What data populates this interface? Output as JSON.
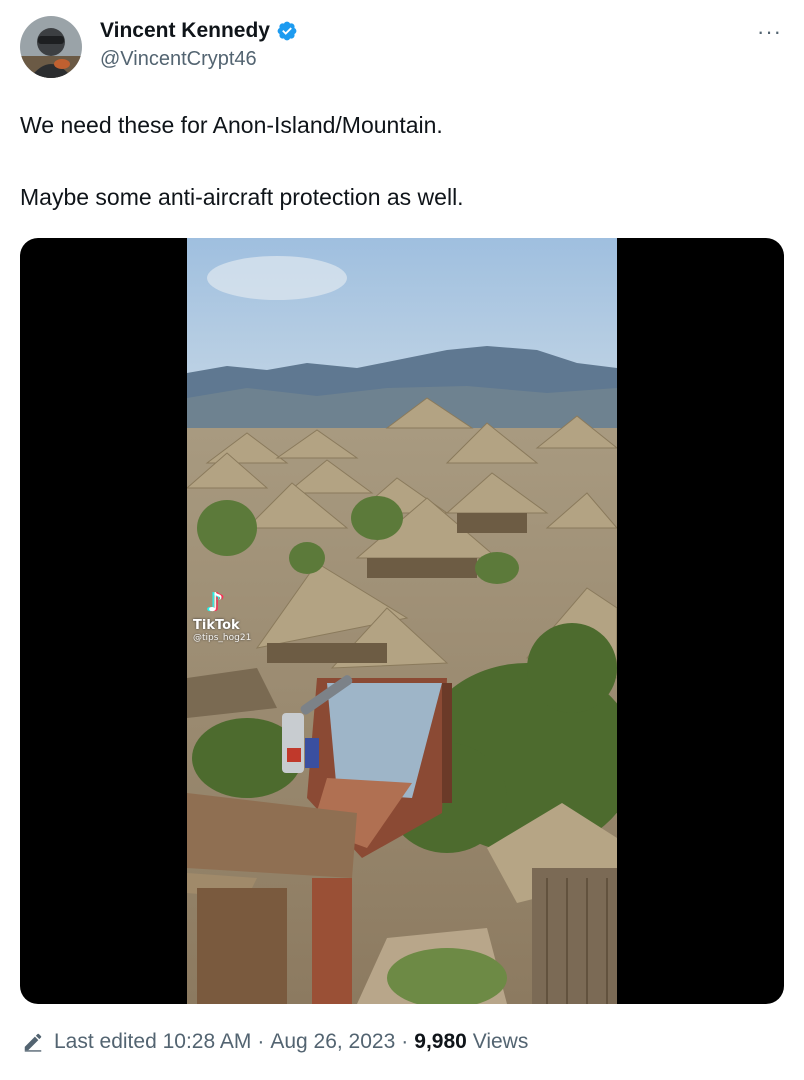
{
  "author": {
    "display_name": "Vincent Kennedy",
    "handle": "@VincentCrypt46",
    "verified": true,
    "verified_color": "#1d9bf0"
  },
  "more_label": "···",
  "tweet": {
    "lines": [
      "We need these for Anon-Island/Mountain.",
      "Maybe some anti-aircraft protection as well."
    ]
  },
  "media": {
    "watermark_app": "TikTok",
    "watermark_user": "@tips_hog21",
    "watermark_glyph": "♪"
  },
  "footer": {
    "edit_prefix": "Last edited",
    "time": "10:28 AM",
    "dot": "·",
    "date": "Aug 26, 2023",
    "views_count": "9,980",
    "views_label": "Views"
  },
  "icons": [
    "avatar",
    "verified-badge-icon",
    "more-icon",
    "pencil-icon",
    "tiktok-icon"
  ]
}
